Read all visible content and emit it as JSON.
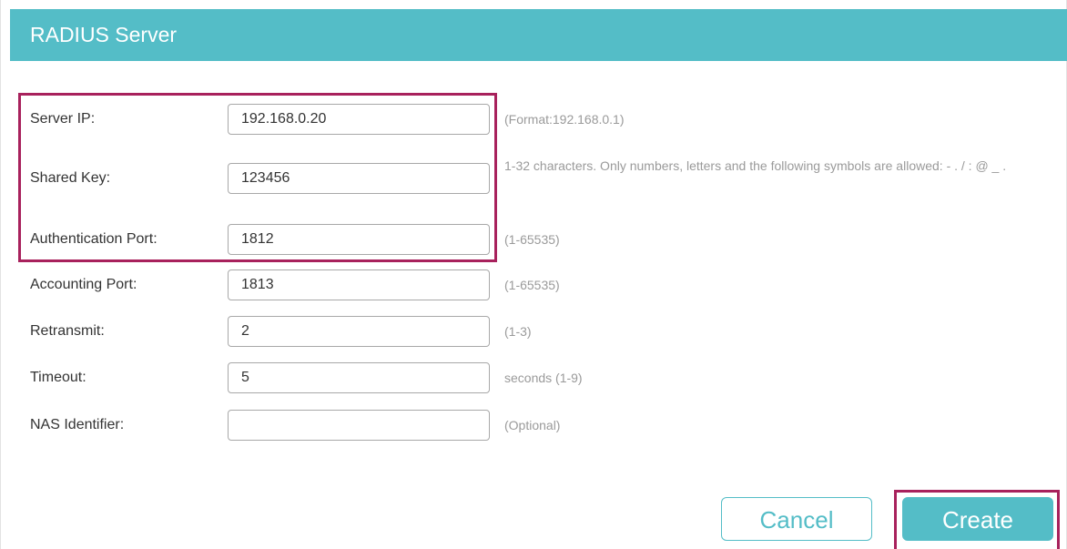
{
  "panel": {
    "title": "RADIUS Server"
  },
  "form": {
    "server_ip": {
      "label": "Server IP:",
      "value": "192.168.0.20",
      "hint": "(Format:192.168.0.1)"
    },
    "shared_key": {
      "label": "Shared Key:",
      "value": "123456",
      "hint": "1-32 characters. Only numbers, letters and the following symbols are allowed: - . / : @ _ ."
    },
    "auth_port": {
      "label": "Authentication Port:",
      "value": "1812",
      "hint": "(1-65535)"
    },
    "acct_port": {
      "label": "Accounting Port:",
      "value": "1813",
      "hint": "(1-65535)"
    },
    "retransmit": {
      "label": "Retransmit:",
      "value": "2",
      "hint": "(1-3)"
    },
    "timeout": {
      "label": "Timeout:",
      "value": "5",
      "hint": "seconds (1-9)"
    },
    "nas_identifier": {
      "label": "NAS Identifier:",
      "value": "",
      "hint": "(Optional)"
    }
  },
  "actions": {
    "cancel_label": "Cancel",
    "create_label": "Create"
  },
  "colors": {
    "header_bg": "#54bdc7",
    "highlight": "#a8215c",
    "hint_text": "#9a9a9a"
  }
}
